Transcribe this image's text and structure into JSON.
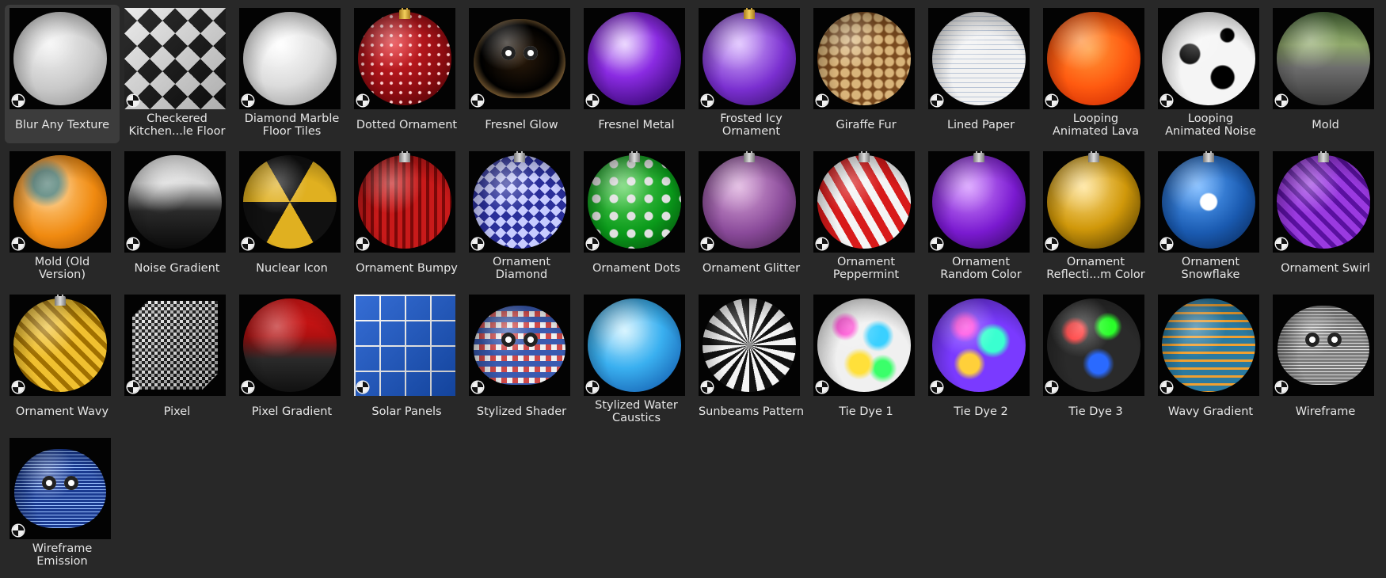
{
  "colors": {
    "background": "#282828",
    "selected": "#3c3c3c",
    "label": "#e6e6e6"
  },
  "assets": [
    {
      "label": "Blur Any Texture",
      "shape": "sphere",
      "bg": "radial-gradient(circle at 40% 35%, #f4f4f4, #c8c8c8 55%, #8a8a8a 100%)",
      "selected": true
    },
    {
      "label": "Checkered\nKitchen...le Floor",
      "shape": "full",
      "bg": "conic-gradient(from 45deg, #111 0 25%, #e8e8e8 0 50%, #111 0 75%, #e8e8e8 0) 0 0/32px 32px"
    },
    {
      "label": "Diamond Marble\nFloor Tiles",
      "shape": "sphere",
      "bg": "radial-gradient(circle at 40% 35%, #ffffff, #dcdcdc 50%, #8f8f8f 100%)"
    },
    {
      "label": "Dotted Ornament",
      "shape": "sphere",
      "cap": "gold",
      "bg": "radial-gradient(circle, #ffd0d0 1.5px, transparent 2.5px) 0 0/12px 12px, radial-gradient(circle at 40% 35%, #e2242a, #8a0b10 60%, #3a0204 100%)"
    },
    {
      "label": "Fresnel Glow",
      "shape": "monkey",
      "bg": "radial-gradient(ellipse at 50% 50%, #2a1a0a, #000 60%, #d9a35a 85%, #5a3a10 100%)"
    },
    {
      "label": "Fresnel Metal",
      "shape": "sphere",
      "bg": "radial-gradient(circle at 40% 35%, #e4c8ff, #8a2be2 40%, #4a0f8c 75%, #7fd0ff 100%)"
    },
    {
      "label": "Frosted Icy\nOrnament",
      "shape": "sphere",
      "cap": "gold",
      "bg": "radial-gradient(circle at 40% 35%, #d9b6ff, #7a2fd0 55%, #2c0b5a 100%)"
    },
    {
      "label": "Giraffe Fur",
      "shape": "sphere",
      "bg": "radial-gradient(circle, #d9b47a 5px, #7a4a1e 7px, #7a4a1e 8px) 0 0/14px 14px"
    },
    {
      "label": "Lined Paper",
      "shape": "sphere",
      "bg": "repeating-linear-gradient(180deg, #f2f2f2 0 5px, #b8c4d6 5px 6px), #f2f2f2"
    },
    {
      "label": "Looping\nAnimated Lava",
      "shape": "sphere",
      "bg": "radial-gradient(circle at 45% 40%, #ff9a3a, #ff5a10 50%, #c42000 100%)"
    },
    {
      "label": "Looping\nAnimated Noise",
      "shape": "sphere",
      "bg": "radial-gradient(circle at 30% 45%, #000 12px, transparent 14px), radial-gradient(circle at 65% 70%, #000 14px, transparent 16px), radial-gradient(circle at 70% 25%, #000 8px, transparent 10px), #f5f5f5"
    },
    {
      "label": "Mold",
      "shape": "sphere",
      "bg": "linear-gradient(180deg, #4a6a3a 0%, #8fa86a 35%, #6d6d6d 60%, #3a3a3a 100%)"
    },
    {
      "label": "Mold (Old\nVersion)",
      "shape": "sphere",
      "bg": "radial-gradient(circle at 35% 30%, #4a7a70 16px, transparent 30px), radial-gradient(circle at 40% 40%, #ffd08a, #f08a10 55%, #9a4a00 100%)"
    },
    {
      "label": "Noise Gradient",
      "shape": "sphere",
      "bg": "linear-gradient(180deg, #f2f2f2 0%, #d8d8d8 30%, #2a2a2a 60%, #0a0a0a 100%)"
    },
    {
      "label": "Nuclear Icon",
      "shape": "sphere",
      "bg": "conic-gradient(from -30deg, #111 0 60deg, #e0b020 0 120deg, #111 0 180deg, #e0b020 0 240deg, #111 0 300deg, #e0b020 0 360deg)"
    },
    {
      "label": "Ornament Bumpy",
      "shape": "sphere",
      "cap": "silver",
      "bg": "repeating-linear-gradient(90deg, #c81a1a 0 6px, #7a0808 6px 10px)"
    },
    {
      "label": "Ornament\nDiamond",
      "shape": "sphere",
      "cap": "silver",
      "bg": "conic-gradient(from 45deg, #2a2f9a 0 25%, #c8ccff 0 50%, #2a2f9a 0 75%, #c8ccff 0) 0 0/14px 14px"
    },
    {
      "label": "Ornament Dots",
      "shape": "sphere",
      "cap": "silver",
      "bg": "radial-gradient(circle, #e0e0e0 5px, transparent 6px) 0 0/22px 22px, radial-gradient(circle at 40% 35%, #5ad05a, #0a9a1a 55%, #03400a 100%)"
    },
    {
      "label": "Ornament Glitter",
      "shape": "sphere",
      "cap": "silver",
      "bg": "radial-gradient(circle at 40% 35%, #d9a6d9, #8a4a9a 55%, #3a1a40 100%)"
    },
    {
      "label": "Ornament\nPeppermint",
      "shape": "sphere",
      "cap": "silver",
      "bg": "repeating-linear-gradient(60deg, #d81a1a 0 10px, #f4f4f4 10px 20px)"
    },
    {
      "label": "Ornament\nRandom Color",
      "shape": "sphere",
      "cap": "silver",
      "bg": "radial-gradient(circle at 40% 35%, #d08aff, #7a1ad0 55%, #2a0550 100%)"
    },
    {
      "label": "Ornament\nReflecti...m Color",
      "shape": "sphere",
      "cap": "silver",
      "bg": "radial-gradient(circle at 40% 35%, #ffe08a, #d0980a 50%, #3a2a00 100%)"
    },
    {
      "label": "Ornament\nSnowflake",
      "shape": "sphere",
      "cap": "silver",
      "bg": "radial-gradient(circle at 50% 50%, #ffffff 10px, transparent 12px), radial-gradient(circle at 40% 35%, #5aa8ff, #1a5ab0 55%, #06204a 100%)"
    },
    {
      "label": "Ornament Swirl",
      "shape": "sphere",
      "cap": "silver",
      "bg": "repeating-linear-gradient(45deg, #9a3ae0 0 8px, #5a10a0 8px 14px)"
    },
    {
      "label": "Ornament Wavy",
      "shape": "sphere",
      "cap": "silver",
      "bg": "repeating-linear-gradient(45deg, #f0c030 0 8px, #a07000 8px 14px)"
    },
    {
      "label": "Pixel",
      "shape": "cube",
      "bg": "conic-gradient(#f0f0f0 0 25%, #111 0 50%, #bbb 0 75%, #111 0) 0 0/8px 8px"
    },
    {
      "label": "Pixel Gradient",
      "shape": "sphere",
      "bg": "linear-gradient(180deg, #e81a1a 0%, #b01010 40%, #2a2a2a 65%, #111 100%)"
    },
    {
      "label": "Solar Panels",
      "shape": "full",
      "bg": "linear-gradient(#fff 2px, transparent 2px) 0 0/32px 32px, linear-gradient(90deg, #fff 2px, transparent 2px) 0 0/32px 32px, #1a5ad0"
    },
    {
      "label": "Stylized Shader",
      "shape": "monkey",
      "bg": "conic-gradient(#3a5ab0 0 25%, #d04a4a 0 50%, #f0f0f0 0 75%, #3a5ab0 0) 0 0/14px 14px"
    },
    {
      "label": "Stylized Water\nCaustics",
      "shape": "sphere",
      "bg": "radial-gradient(circle at 40% 35%, #c8f0ff, #3ab0f0 45%, #0a4aa0 100%)"
    },
    {
      "label": "Sunbeams Pattern",
      "shape": "sphere",
      "bg": "repeating-conic-gradient(from 0deg at 50% 50%, #f4f4f4 0 10deg, #111 10deg 20deg)"
    },
    {
      "label": "Tie Dye 1",
      "shape": "sphere",
      "bg": "radial-gradient(circle at 30% 30%, #ff3ad0 10px, transparent 18px), radial-gradient(circle at 65% 40%, #3ad0ff 12px, transparent 20px), radial-gradient(circle at 45% 70%, #ffe03a 12px, transparent 20px), radial-gradient(circle at 70% 75%, #3aff6a 10px, transparent 18px), #f0f0f0"
    },
    {
      "label": "Tie Dye 2",
      "shape": "sphere",
      "bg": "radial-gradient(circle at 35% 30%, #ff3ae0 10px, transparent 20px), radial-gradient(circle at 65% 45%, #3affd0 14px, transparent 22px), radial-gradient(circle at 40% 70%, #ffd03a 12px, transparent 20px), #7a3aff"
    },
    {
      "label": "Tie Dye 3",
      "shape": "sphere",
      "bg": "radial-gradient(circle at 30% 35%, #ff2a2a 10px, transparent 18px), radial-gradient(circle at 65% 30%, #2aff2a 10px, transparent 18px), radial-gradient(circle at 55% 70%, #2a6aff 12px, transparent 20px), #2a2a2a"
    },
    {
      "label": "Wavy Gradient",
      "shape": "sphere",
      "bg": "repeating-linear-gradient(180deg, #2a7aa0 0 7px, #f0a030 7px 10px)"
    },
    {
      "label": "Wireframe",
      "shape": "monkey",
      "bg": "repeating-linear-gradient(0deg, #e0e0e0 0 1px, #7a7a7a 1px 4px), #9a9a9a"
    },
    {
      "label": "Wireframe\nEmission",
      "shape": "monkey",
      "bg": "repeating-linear-gradient(0deg, #9ac0ff 0 1px, #1a3a90 1px 4px), #1a3a90"
    }
  ]
}
